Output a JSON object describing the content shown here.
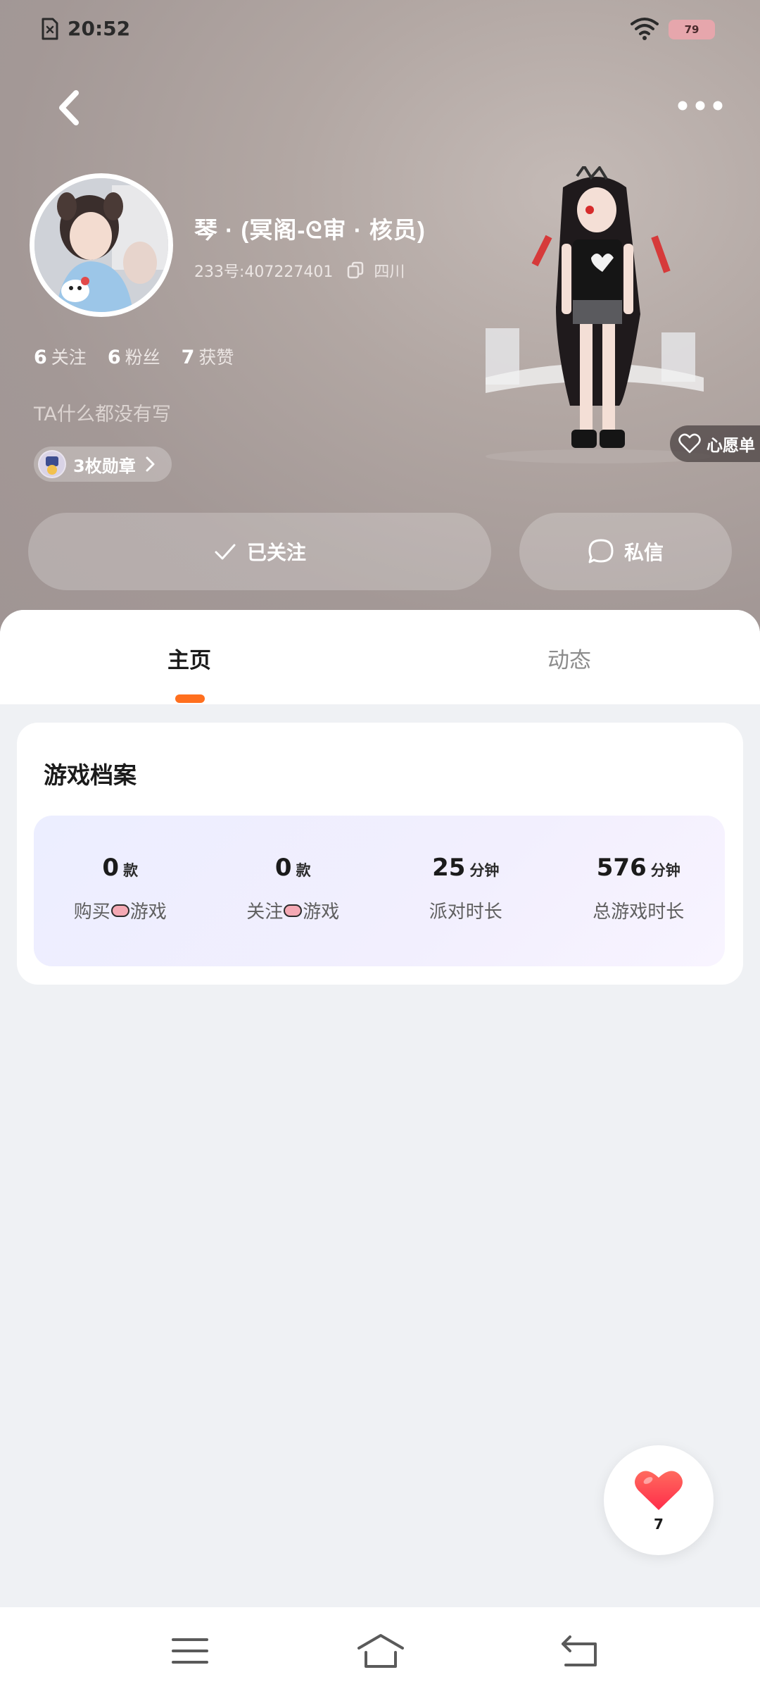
{
  "status_bar": {
    "time": "20:52",
    "battery": "79"
  },
  "profile": {
    "username": "琴 · (冥阁-ᘓ审 · 核员)",
    "user_id": "233号:407227401",
    "location": "四川",
    "stats": [
      {
        "count": "6",
        "label": "关注"
      },
      {
        "count": "6",
        "label": "粉丝"
      },
      {
        "count": "7",
        "label": "获赞"
      }
    ],
    "bio": "TA什么都没有写",
    "medals": "3枚勋章",
    "wishlist": "心愿单"
  },
  "actions": {
    "follow": "已关注",
    "message": "私信"
  },
  "tabs": [
    {
      "label": "主页",
      "active": true
    },
    {
      "label": "动态",
      "active": false
    }
  ],
  "game_archive": {
    "title": "游戏档案",
    "stats": [
      {
        "value": "0",
        "unit": "款",
        "label_before": "购买",
        "label_after": "游戏",
        "pill": true
      },
      {
        "value": "0",
        "unit": "款",
        "label_before": "关注",
        "label_after": "游戏",
        "pill": true
      },
      {
        "value": "25",
        "unit": "分钟",
        "label_before": "派对时长",
        "label_after": "",
        "pill": false
      },
      {
        "value": "576",
        "unit": "分钟",
        "label_before": "总游戏时长",
        "label_after": "",
        "pill": false
      }
    ]
  },
  "like_fab": {
    "count": "7"
  },
  "colors": {
    "accent": "#ff6f1e",
    "heart": "#ff3b47"
  },
  "icons": [
    "sim-icon",
    "wifi-icon",
    "back-icon",
    "more-icon",
    "copy-icon",
    "chevron-right-icon",
    "check-icon",
    "chat-icon",
    "heart-outline-icon",
    "heart-icon",
    "menu-icon",
    "home-icon",
    "return-icon"
  ]
}
